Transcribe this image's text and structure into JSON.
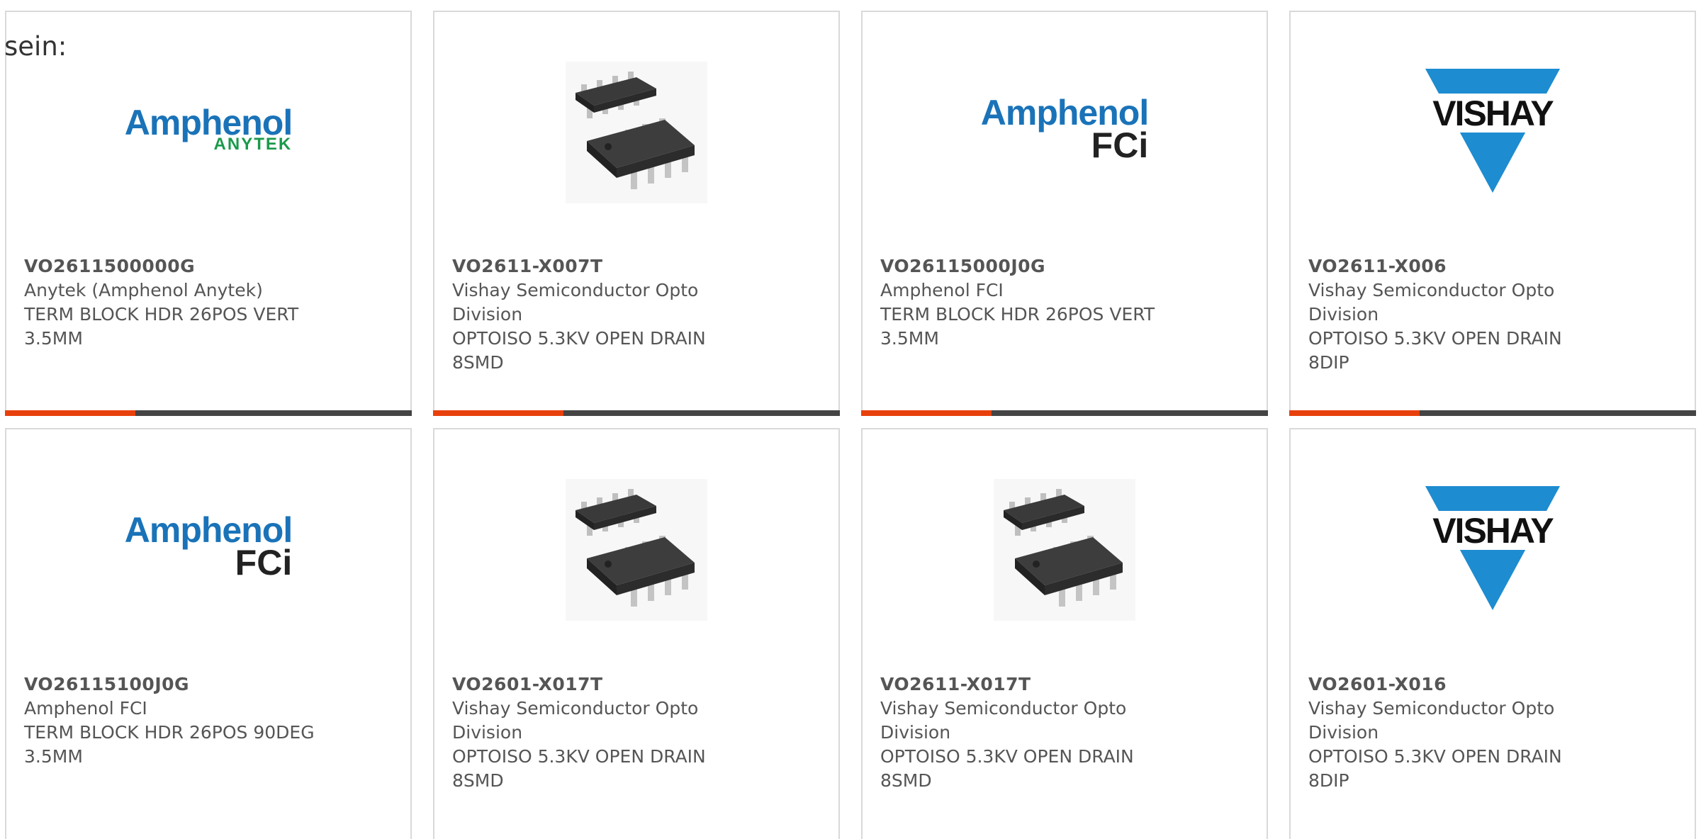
{
  "intro_text": "sein:",
  "colors": {
    "accent": "#e8400c",
    "bar": "#444444",
    "border": "#d9d9d9"
  },
  "cards": [
    {
      "part": "VO2611500000G",
      "manufacturer": "Anytek (Amphenol Anytek)",
      "description": "TERM BLOCK HDR 26POS VERT 3.5MM",
      "image": "amphenol-anytek-logo",
      "logo_word": "Amphenol",
      "logo_sub": "ANYTEK"
    },
    {
      "part": "VO2611-X007T",
      "manufacturer": "Vishay Semiconductor Opto Division",
      "description": "OPTOISO 5.3KV OPEN DRAIN 8SMD",
      "image": "soic8-chip-photo"
    },
    {
      "part": "VO26115000J0G",
      "manufacturer": "Amphenol FCI",
      "description": "TERM BLOCK HDR 26POS VERT 3.5MM",
      "image": "amphenol-fci-logo",
      "logo_word": "Amphenol",
      "logo_sub": "FCi"
    },
    {
      "part": "VO2611-X006",
      "manufacturer": "Vishay Semiconductor Opto Division",
      "description": "OPTOISO 5.3KV OPEN DRAIN 8DIP",
      "image": "vishay-logo",
      "logo_word": "VISHAY"
    },
    {
      "part": "VO26115100J0G",
      "manufacturer": "Amphenol FCI",
      "description": "TERM BLOCK HDR 26POS 90DEG 3.5MM",
      "image": "amphenol-fci-logo",
      "logo_word": "Amphenol",
      "logo_sub": "FCi"
    },
    {
      "part": "VO2601-X017T",
      "manufacturer": "Vishay Semiconductor Opto Division",
      "description": "OPTOISO 5.3KV OPEN DRAIN 8SMD",
      "image": "soic8-chip-photo"
    },
    {
      "part": "VO2611-X017T",
      "manufacturer": "Vishay Semiconductor Opto Division",
      "description": "OPTOISO 5.3KV OPEN DRAIN 8SMD",
      "image": "soic8-chip-photo"
    },
    {
      "part": "VO2601-X016",
      "manufacturer": "Vishay Semiconductor Opto Division",
      "description": "OPTOISO 5.3KV OPEN DRAIN 8DIP",
      "image": "vishay-logo",
      "logo_word": "VISHAY"
    }
  ]
}
